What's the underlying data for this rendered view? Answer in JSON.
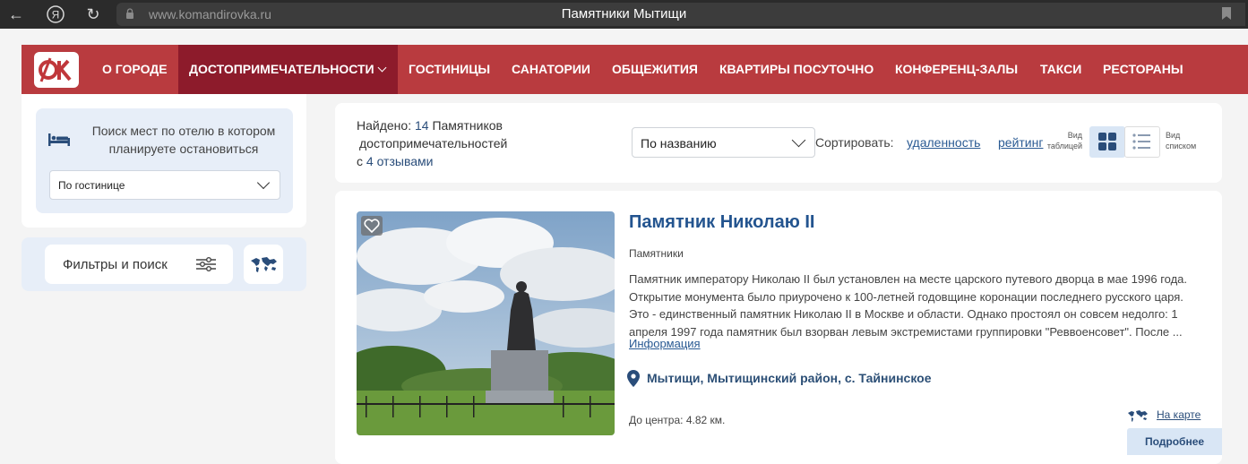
{
  "browser": {
    "url": "www.komandirovka.ru",
    "tab_title": "Памятники Мытищи"
  },
  "nav": {
    "logo_text": "ОК",
    "items": [
      {
        "label": "О ГОРОДЕ"
      },
      {
        "label": "ДОСТОПРИМЕЧАТЕЛЬНОСТИ",
        "active": true
      },
      {
        "label": "ГОСТИНИЦЫ"
      },
      {
        "label": "САНАТОРИИ"
      },
      {
        "label": "ОБЩЕЖИТИЯ"
      },
      {
        "label": "КВАРТИРЫ ПОСУТОЧНО"
      },
      {
        "label": "КОНФЕРЕНЦ-ЗАЛЫ"
      },
      {
        "label": "ТАКСИ"
      },
      {
        "label": "РЕСТОРАНЫ"
      }
    ]
  },
  "sidebar": {
    "hotel_search_text": "Поиск мест по отелю в котором планируете остановиться",
    "hotel_select_value": "По гостинице",
    "filter_button_label": "Фильтры и поиск"
  },
  "sortbar": {
    "found_prefix": "Найдено:",
    "found_count": "14",
    "found_type": "Памятников",
    "found_sub": "достопримечательностей",
    "reviews_prefix": "с",
    "reviews_count": "4",
    "reviews_label": "отзывами",
    "sort_select_value": "По названию",
    "sort_label": "Сортировать:",
    "sort_distance": "удаленность",
    "sort_rating": "рейтинг",
    "view_table_line1": "Вид",
    "view_table_line2": "таблицей",
    "view_list_line1": "Вид",
    "view_list_line2": "списком"
  },
  "listing": {
    "title": "Памятник Николаю II",
    "category": "Памятники",
    "description": "Памятник императору Николаю II был установлен на месте царского путевого дворца в мае 1996 года. Открытие монумента было приурочено к 100-летней годовщине коронации последнего русского царя. Это - единственный памятник Николаю II в Москве и области. Однако простоял он совсем недолго: 1 апреля 1997 года памятник был взорван левым экстремистами группировки \"Реввоенсовет\". После ...",
    "more_info_link": "Информация",
    "address": "Мытищи, Мытищинский район, с. Тайнинское",
    "distance": "До центра: 4.82 км.",
    "on_map": "На карте",
    "details_button": "Подробнее"
  },
  "colors": {
    "nav_bg": "#b93b3f",
    "nav_active": "#8d1b2b",
    "link_blue": "#2a5a93",
    "title_blue": "#23548f",
    "panel_blue": "#e7eef8"
  },
  "icons": [
    "back-icon",
    "yandex-icon",
    "reload-icon",
    "lock-icon",
    "bookmark-icon",
    "bed-icon",
    "filter-sliders-icon",
    "world-map-icon",
    "tile-view-icon",
    "list-view-icon",
    "heart-icon",
    "location-pin-icon"
  ]
}
